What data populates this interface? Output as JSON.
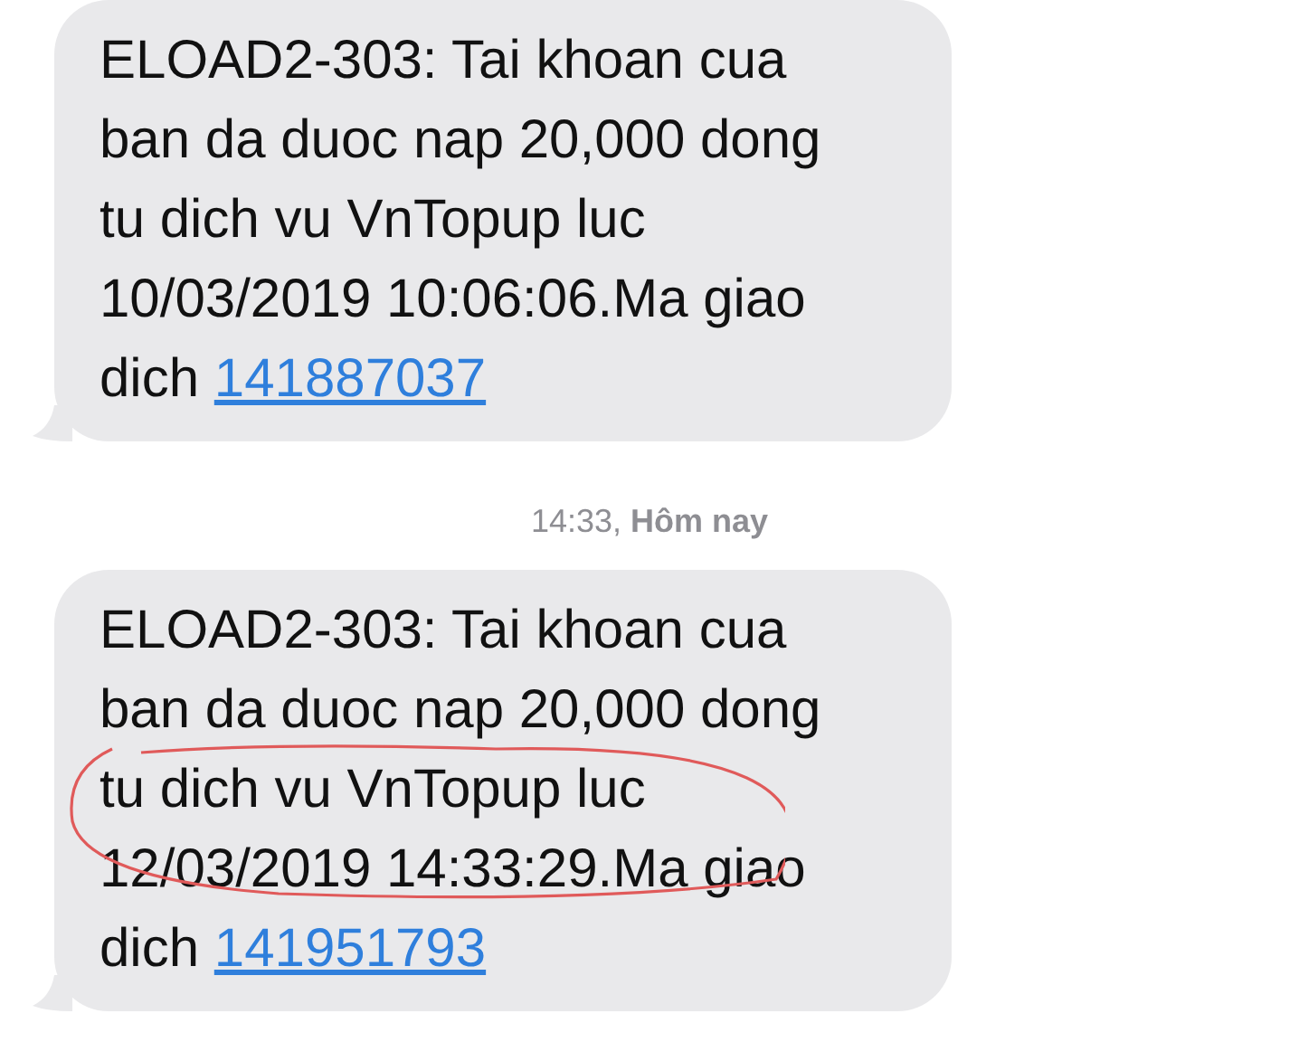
{
  "messages": [
    {
      "lines": [
        "ELOAD2-303: Tai khoan cua",
        "ban da duoc nap 20,000 dong",
        "tu dich vu VnTopup luc",
        "10/03/2019 10:06:06.Ma giao",
        "dich"
      ],
      "link": "141887037",
      "circled": false
    },
    {
      "timestamp": "14:33, **Hôm nay**",
      "lines": [
        "ELOAD2-303: Tai khoan cua",
        "ban da duoc nap 20,000 dong",
        "tu dich vu VnTopup luc",
        "12/03/2019 14:33:29.Ma giao",
        "dich"
      ],
      "link": "141951793",
      "circled": true
    }
  ]
}
